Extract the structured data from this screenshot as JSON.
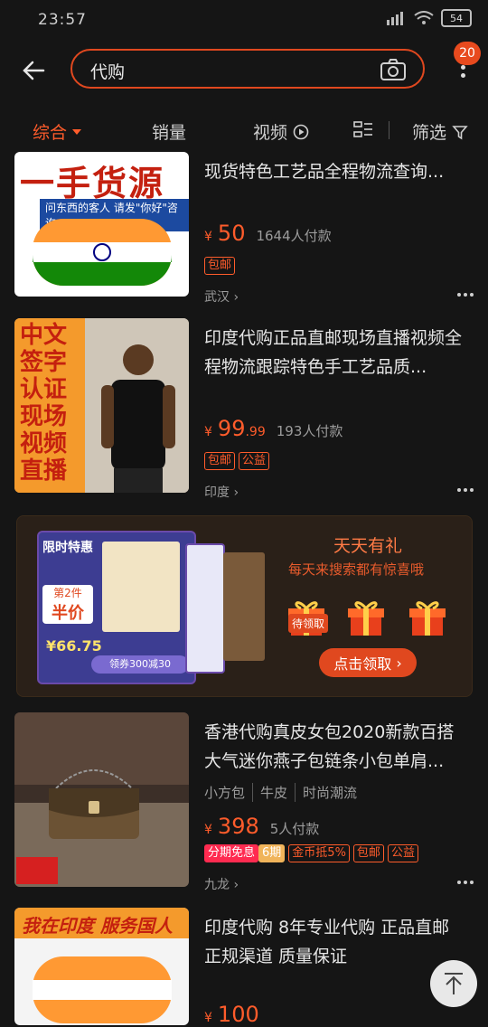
{
  "status": {
    "time": "23:57",
    "battery": "54"
  },
  "header": {
    "search_value": "代购",
    "badge": "20"
  },
  "sort": {
    "tabs": [
      "综合",
      "销量",
      "视频",
      "筛选"
    ]
  },
  "items": [
    {
      "thumb_text": "一手货源",
      "thumb_sub": "问东西的客人  请发\"你好\"咨询",
      "title": "现货特色工艺品全程物流查询...",
      "price": "50",
      "sales": "1644人付款",
      "tags": [
        "包邮"
      ],
      "location": "武汉"
    },
    {
      "thumb_text": "中文签字认证 现场视频直播",
      "title": "印度代购正品直邮现场直播视频全程物流跟踪特色手工艺品质...",
      "price": "99",
      "price_decimal": ".99",
      "sales": "193人付款",
      "tags": [
        "包邮",
        "公益"
      ],
      "location": "印度"
    },
    {
      "thumb_text": "",
      "title": "香港代购真皮女包2020新款百搭大气迷你燕子包链条小包单肩...",
      "attrs": [
        "小方包",
        "牛皮",
        "时尚潮流"
      ],
      "price": "398",
      "sales": "5人付款",
      "tags": [
        "分期免息",
        "6期",
        "金币抵5%",
        "包邮",
        "公益"
      ],
      "location": "九龙"
    },
    {
      "thumb_text": "我在印度 服务国人",
      "title": "印度代购 8年专业代购 正品直邮 正规渠道 质量保证",
      "price": "100"
    }
  ],
  "promo": {
    "title": "天天有礼",
    "subtitle": "每天来搜索都有惊喜哦",
    "gift_label": "待领取",
    "button": "点击领取",
    "card": {
      "label_limited": "限时特惠",
      "label_second": "第2件",
      "label_half": "半价",
      "label_price": "66.75",
      "label_coupon": "领券300减30"
    }
  },
  "colors": {
    "accent": "#ff5c2b",
    "background": "#151515"
  }
}
